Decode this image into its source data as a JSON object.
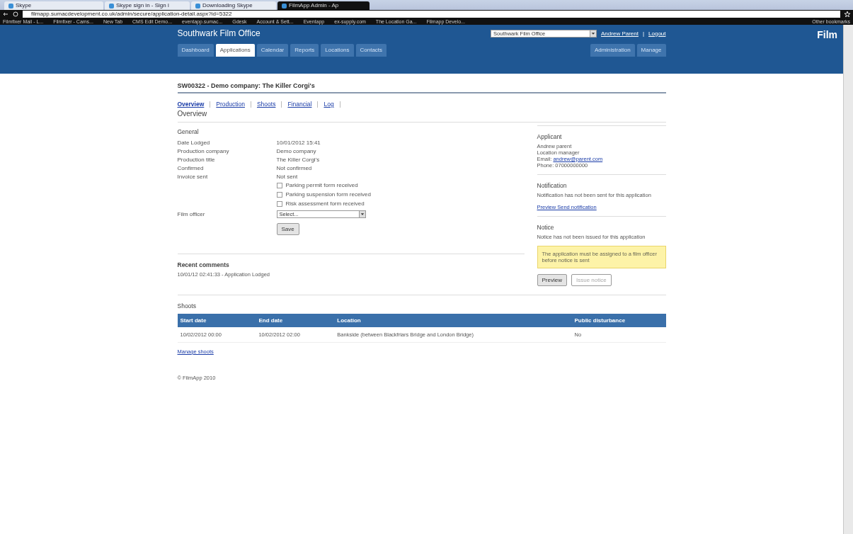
{
  "browser": {
    "tabs": [
      {
        "label": "Skype",
        "selected": false
      },
      {
        "label": "Skype sign in - Sign i",
        "selected": false
      },
      {
        "label": "Downloading Skype",
        "selected": false
      },
      {
        "label": "FilmApp Admin - Ap",
        "selected": true
      }
    ],
    "address": "filmapp.sumacdevelopment.co.uk/admin/secure/application-detail.aspx?id=5322",
    "bookmarks": [
      "Filmfixer Mail - L...",
      "Filmfixer - Cams...",
      "New Tab",
      "CMS Edit Demo...",
      "eventapp.sumac...",
      "Gdesk",
      "Account & Sett...",
      "Eventapp",
      "ex-supply.com",
      "The Location Ga...",
      "Filmapp Develo..."
    ],
    "other_bookmarks": "Other bookmarks"
  },
  "header": {
    "site_title": "Southwark Film Office",
    "office_select": "Southwark Film Office",
    "user": "Andrew Parent",
    "separator": "|",
    "logout": "Logout",
    "logo": "Film"
  },
  "nav": {
    "left": [
      {
        "label": "Dashboard",
        "selected": false
      },
      {
        "label": "Applications",
        "selected": true
      },
      {
        "label": "Calendar",
        "selected": false
      },
      {
        "label": "Reports",
        "selected": false
      },
      {
        "label": "Locations",
        "selected": false
      },
      {
        "label": "Contacts",
        "selected": false
      }
    ],
    "right": [
      {
        "label": "Administration",
        "selected": false
      },
      {
        "label": "Manage",
        "selected": false
      }
    ]
  },
  "page_title": "SW00322 - Demo company: The Killer Corgi's",
  "subtabs": [
    {
      "label": "Overview",
      "selected": true
    },
    {
      "label": "Production",
      "selected": false
    },
    {
      "label": "Shoots",
      "selected": false
    },
    {
      "label": "Financial",
      "selected": false
    },
    {
      "label": "Log",
      "selected": false
    }
  ],
  "section_heading": "Overview",
  "general": {
    "heading": "General",
    "rows": [
      {
        "label": "Date Lodged",
        "value": "10/01/2012 15:41"
      },
      {
        "label": "Production company",
        "value": "Demo company"
      },
      {
        "label": "Production title",
        "value": "The Killer Corgi's"
      },
      {
        "label": "Confirmed",
        "value": "Not confirmed"
      },
      {
        "label": "Invoice sent",
        "value": "Not sent"
      }
    ],
    "checkboxes": [
      {
        "label": "Parking permit form received",
        "checked": false
      },
      {
        "label": "Parking suspension form received",
        "checked": false
      },
      {
        "label": "Risk assessment form received",
        "checked": false
      }
    ],
    "officer_label": "Film officer",
    "officer_select": "Select...",
    "save": "Save"
  },
  "comments": {
    "heading": "Recent comments",
    "items": [
      "10/01/12 02:41:33 - Application Lodged"
    ]
  },
  "applicant": {
    "heading": "Applicant",
    "name": "Andrew parent",
    "role": "Location manager",
    "email_label": "Email:",
    "email": "andrew@parent.com",
    "phone": "Phone: 07000000000"
  },
  "notification": {
    "heading": "Notification",
    "text": "Notification has not been sent for this application",
    "link": "Preview Send notification"
  },
  "notice": {
    "heading": "Notice",
    "text": "Notice has not been issued for this application",
    "warning": "The application must be assigned to a film officer before notice is sent",
    "buttons": [
      {
        "label": "Preview",
        "disabled": false
      },
      {
        "label": "Issue notice",
        "disabled": true
      }
    ]
  },
  "shoots": {
    "heading": "Shoots",
    "columns": [
      "Start date",
      "End date",
      "Location",
      "Public disturbance"
    ],
    "rows": [
      [
        "10/02/2012 00:00",
        "10/02/2012 02:00",
        "Bankside (between Blackfriars Bridge and London Bridge)",
        "No"
      ]
    ],
    "manage": "Manage shoots"
  },
  "footer": "© FilmApp 2010"
}
